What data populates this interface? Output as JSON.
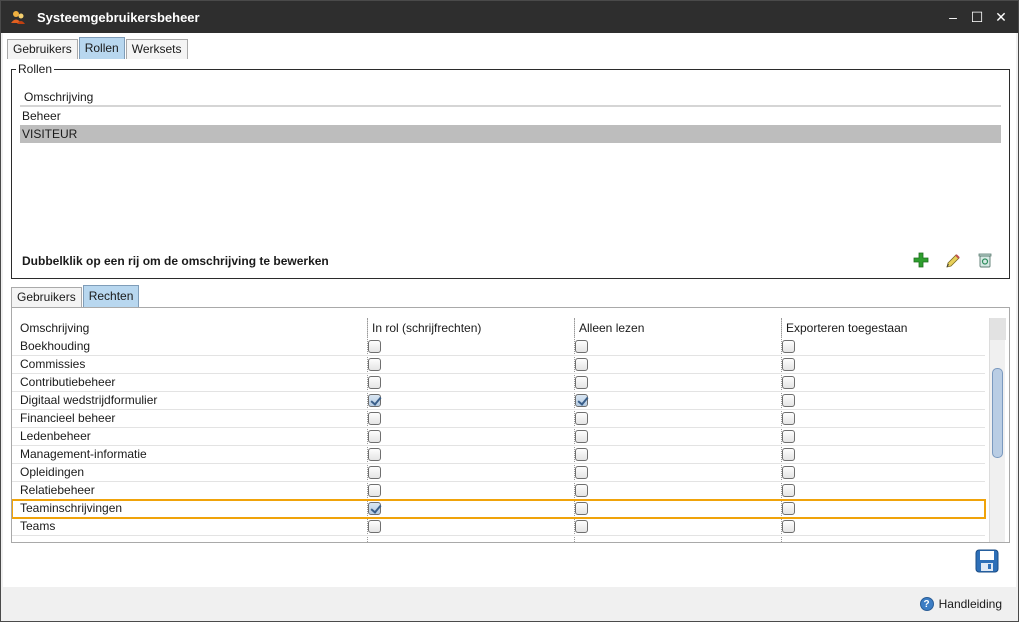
{
  "window": {
    "title": "Systeemgebruikersbeheer",
    "minimize": "–",
    "maximize": "☐",
    "close": "✕"
  },
  "top_tabs": [
    "Gebruikers",
    "Rollen",
    "Werksets"
  ],
  "top_tabs_active": "Rollen",
  "roles": {
    "legend": "Rollen",
    "column": "Omschrijving",
    "rows": [
      "Beheer",
      "VISITEUR"
    ],
    "selected": "VISITEUR",
    "hint": "Dubbelklik op een rij om de omschrijving te bewerken"
  },
  "bottom_tabs": [
    "Gebruikers",
    "Rechten"
  ],
  "bottom_tabs_active": "Rechten",
  "rights": {
    "columns": [
      "Omschrijving",
      "In rol (schrijfrechten)",
      "Alleen lezen",
      "Exporteren toegestaan"
    ],
    "rows": [
      {
        "name": "Boekhouding",
        "in_rol": false,
        "alleen_lezen": false,
        "exporteren": false
      },
      {
        "name": "Commissies",
        "in_rol": false,
        "alleen_lezen": false,
        "exporteren": false
      },
      {
        "name": "Contributiebeheer",
        "in_rol": false,
        "alleen_lezen": false,
        "exporteren": false
      },
      {
        "name": "Digitaal wedstrijdformulier",
        "in_rol": true,
        "alleen_lezen": true,
        "exporteren": false
      },
      {
        "name": "Financieel beheer",
        "in_rol": false,
        "alleen_lezen": false,
        "exporteren": false
      },
      {
        "name": "Ledenbeheer",
        "in_rol": false,
        "alleen_lezen": false,
        "exporteren": false
      },
      {
        "name": "Management-informatie",
        "in_rol": false,
        "alleen_lezen": false,
        "exporteren": false
      },
      {
        "name": "Opleidingen",
        "in_rol": false,
        "alleen_lezen": false,
        "exporteren": false
      },
      {
        "name": "Relatiebeheer",
        "in_rol": false,
        "alleen_lezen": false,
        "exporteren": false
      },
      {
        "name": "Teaminschrijvingen",
        "in_rol": true,
        "alleen_lezen": false,
        "exporteren": false,
        "highlighted": true
      },
      {
        "name": "Teams",
        "in_rol": false,
        "alleen_lezen": false,
        "exporteren": false
      }
    ]
  },
  "footer": {
    "help_label": "Handleiding"
  },
  "icons": {
    "app": "users-icon",
    "add": "add-icon",
    "edit": "pencil-icon",
    "delete": "trash-icon",
    "save": "save-icon",
    "help": "help-icon"
  },
  "colors": {
    "titlebar": "#2e2e2e",
    "active_tab": "#b8d7ef",
    "selected_row": "#bdbdbd",
    "highlight": "#f0a30a",
    "add": "#2e9e2e"
  }
}
